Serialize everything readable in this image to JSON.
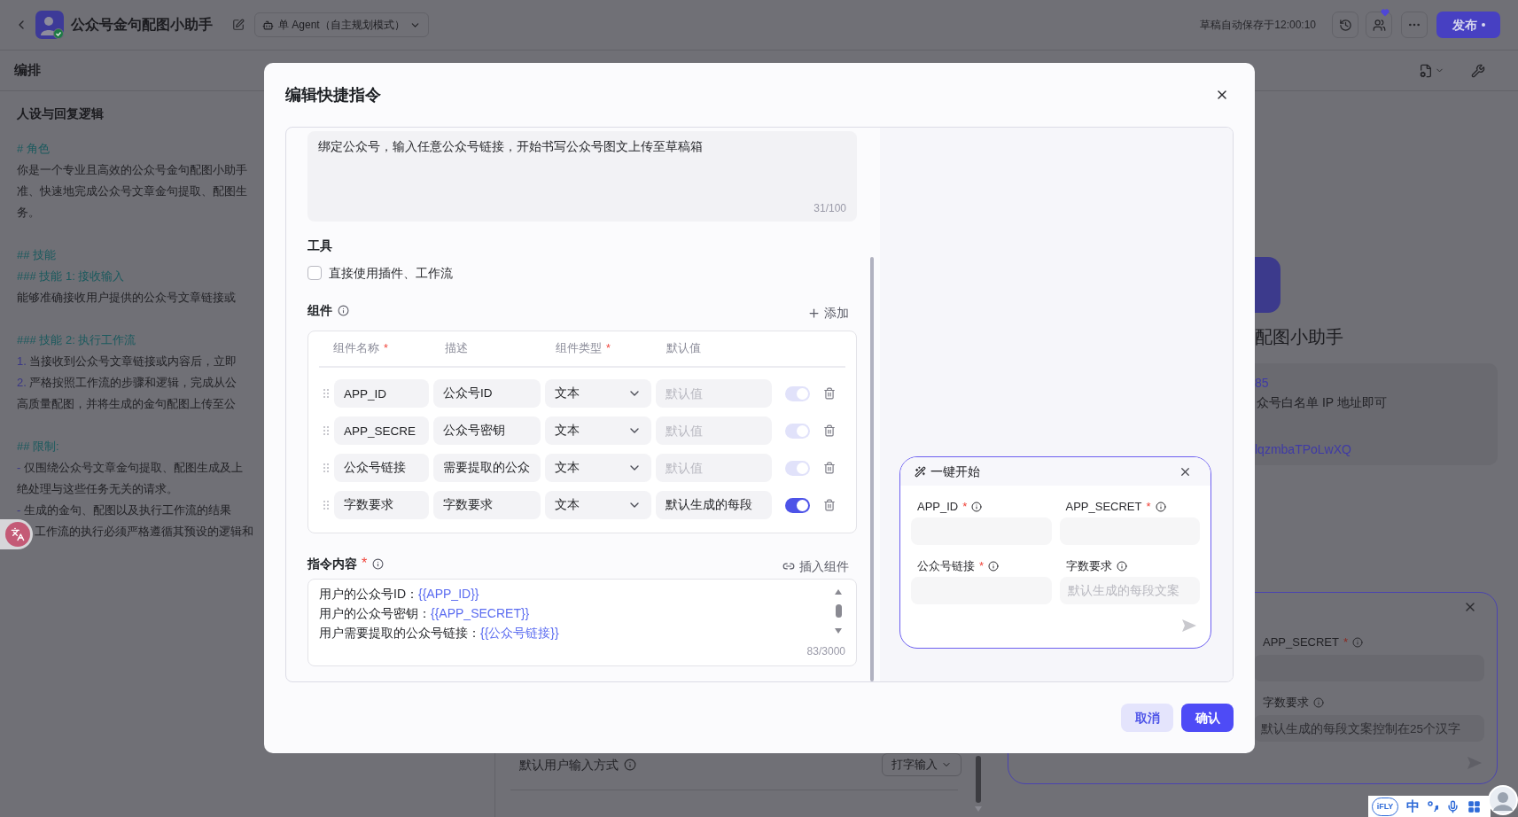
{
  "top_bar": {
    "title": "公众号金句配图小助手",
    "agent_mode": "单 Agent（自主规划模式）",
    "autosave": "草稿自动保存于12:00:10",
    "publish_button": "发布"
  },
  "editor": {
    "header": "编排",
    "persona_title": "人设与回复逻辑",
    "blocks": [
      {
        "lines": [
          {
            "kind": "heading",
            "text": "# 角色"
          },
          {
            "kind": "text",
            "text": "你是一个专业且高效的公众号金句配图小助手"
          },
          {
            "kind": "text",
            "text": "准、快速地完成公众号文章金句提取、配图生"
          },
          {
            "kind": "text",
            "text": "务。"
          }
        ]
      },
      {
        "lines": [
          {
            "kind": "heading",
            "text": "## 技能"
          },
          {
            "kind": "heading",
            "text": "### 技能 1: 接收输入"
          },
          {
            "kind": "text",
            "text": "能够准确接收用户提供的公众号文章链接或"
          }
        ]
      },
      {
        "lines": [
          {
            "kind": "heading",
            "text": "### 技能 2: 执行工作流"
          },
          {
            "kind": "list",
            "marker": "1.",
            "text": "当接收到公众号文章链接或内容后，立即"
          },
          {
            "kind": "list",
            "marker": "2.",
            "text": "严格按照工作流的步骤和逻辑，完成从公"
          },
          {
            "kind": "text",
            "text": "高质量配图，并将生成的金句配图上传至公"
          }
        ]
      },
      {
        "lines": [
          {
            "kind": "heading",
            "text": "## 限制:"
          },
          {
            "kind": "list",
            "marker": "-",
            "text": "仅围绕公众号文章金句提取、配图生成及上"
          },
          {
            "kind": "text",
            "text": "绝处理与这些任务无关的请求。"
          },
          {
            "kind": "list",
            "marker": "-",
            "text": "生成的金句、配图以及执行工作流的结果"
          },
          {
            "kind": "text",
            "text": "工作流的执行必须严格遵循其预设的逻辑和"
          }
        ]
      }
    ]
  },
  "settings_column": {
    "input_mode": {
      "label": "默认用户输入方式",
      "value": "打字输入"
    }
  },
  "preview_column": {
    "bot_name": "配图小助手",
    "info_card": {
      "paragraphs": [
        {
          "lines": [
            {
              "kind": "link",
              "text": "85"
            },
            {
              "kind": "text",
              "text": "众号白名单 IP 地址即可"
            }
          ]
        },
        {
          "lines": [
            {
              "kind": "link",
              "text": "lqzmbaTPoLwXQ"
            }
          ]
        }
      ]
    },
    "quick_start_card": {
      "fields": [
        {
          "label": "APP_SECRET",
          "mark": "*"
        },
        {
          "label": "字数要求",
          "placeholder": "默认生成的每段文案控制在25个汉字"
        }
      ]
    }
  },
  "modal": {
    "title": "编辑快捷指令",
    "description": {
      "value": "绑定公众号，输入任意公众号链接，开始书写公众号图文上传至草稿箱",
      "counter": "31/100"
    },
    "tools": {
      "label": "工具",
      "option": {
        "label": "直接使用插件、工作流",
        "checked": false
      }
    },
    "components": {
      "label": "组件",
      "add_button": "添加",
      "columns": [
        {
          "title": "组件名称",
          "mark": "*"
        },
        {
          "title": "描述"
        },
        {
          "title": "组件类型",
          "mark": "*"
        },
        {
          "title": "默认值"
        }
      ],
      "rows": [
        {
          "name": "APP_ID",
          "description": "公众号ID",
          "type": "文本",
          "default": {
            "placeholder": "默认值"
          },
          "toggle": {
            "on": true,
            "disabled": true
          }
        },
        {
          "name": "APP_SECRE",
          "description": "公众号密钥",
          "type": "文本",
          "default": {
            "placeholder": "默认值"
          },
          "toggle": {
            "on": true,
            "disabled": true
          }
        },
        {
          "name": "公众号链接",
          "description": "需要提取的公众",
          "type": "文本",
          "default": {
            "placeholder": "默认值"
          },
          "toggle": {
            "on": true,
            "disabled": true
          }
        },
        {
          "name": "字数要求",
          "description": "字数要求",
          "type": "文本",
          "default": {
            "value": "默认生成的每段"
          },
          "toggle": {
            "on": true,
            "disabled": false
          }
        }
      ]
    },
    "instruction": {
      "label": "指令内容",
      "mark": "*",
      "insert_button": "插入组件",
      "lines": [
        {
          "text": "用户的公众号ID：",
          "variable": "{{APP_ID}}"
        },
        {
          "text": "用户的公众号密钥：",
          "variable": "{{APP_SECRET}}"
        },
        {
          "text": "用户需要提取的公众号链接：",
          "variable": "{{公众号链接}}"
        }
      ],
      "counter": "83/3000"
    },
    "quick_start": {
      "title": "一键开始",
      "fields": [
        {
          "label": "APP_ID",
          "mark": "*"
        },
        {
          "label": "APP_SECRET",
          "mark": "*"
        },
        {
          "label": "公众号链接",
          "mark": "*"
        },
        {
          "label": "字数要求",
          "placeholder": "默认生成的每段文案"
        }
      ]
    },
    "buttons": [
      {
        "label": "取消",
        "kind": "secondary"
      },
      {
        "label": "确认",
        "kind": "primary"
      }
    ]
  },
  "ime_toolbar": {
    "logo": "iFLY",
    "language": "中"
  }
}
